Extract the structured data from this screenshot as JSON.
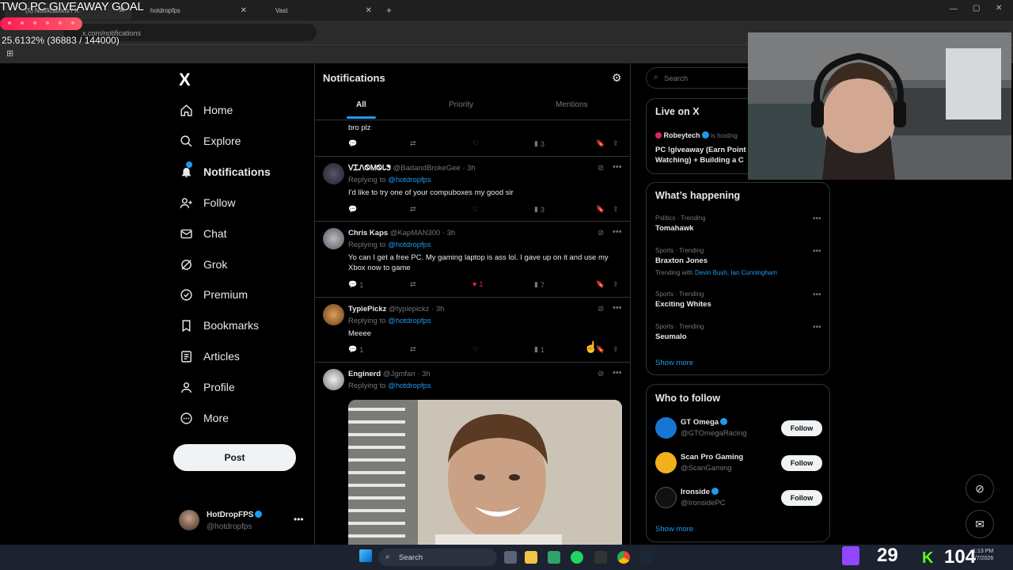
{
  "overlay": {
    "goal_title": "TWO PC GIVEAWAY GOAL",
    "goal_progress": "25.6132% (36883 / 144000)",
    "goal_fraction": 0.256
  },
  "browser": {
    "tabs": [
      {
        "label": "(5) Notifications / X"
      },
      {
        "label": "hotdropfps"
      },
      {
        "label": "Vast"
      }
    ],
    "new_tab": "+",
    "url": "x.com/notifications"
  },
  "sidebar": {
    "logo": "X",
    "items": [
      {
        "label": "Home",
        "icon": "home-icon"
      },
      {
        "label": "Explore",
        "icon": "search-icon"
      },
      {
        "label": "Notifications",
        "icon": "bell-icon",
        "active": true
      },
      {
        "label": "Follow",
        "icon": "person-add-icon"
      },
      {
        "label": "Chat",
        "icon": "mail-icon"
      },
      {
        "label": "Grok",
        "icon": "grok-icon"
      },
      {
        "label": "Premium",
        "icon": "premium-icon"
      },
      {
        "label": "Bookmarks",
        "icon": "bookmark-icon"
      },
      {
        "label": "Articles",
        "icon": "articles-icon"
      },
      {
        "label": "Profile",
        "icon": "profile-icon"
      },
      {
        "label": "More",
        "icon": "more-circle-icon"
      }
    ],
    "post_label": "Post",
    "account": {
      "name": "HotDropFPS",
      "handle": "@hotdropfps"
    }
  },
  "notifications": {
    "title": "Notifications",
    "tabs": [
      "All",
      "Priority",
      "Mentions"
    ],
    "posts": [
      {
        "name": "",
        "handle": "",
        "time": "",
        "reply_to": "",
        "text": "bro plz",
        "replies": "",
        "likes": "",
        "views": "3"
      },
      {
        "name": "ᐯᏆᏁᏫᎷᏫᏓᏕ",
        "handle": "@BadandBrokeGee · 3h",
        "reply_label": "Replying to ",
        "reply_to": "@hotdropfps",
        "text": "I'd like to try one of your compuboxes my good sir",
        "replies": "",
        "likes": "",
        "views": "3"
      },
      {
        "name": "Chris Kaps",
        "handle": "@KapMAN300 · 3h",
        "reply_label": "Replying to ",
        "reply_to": "@hotdropfps",
        "text": "Yo can I get a free PC. My gaming laptop is ass lol. I gave up on it and use my Xbox now to game",
        "replies": "1",
        "likes": "1",
        "views": "7"
      },
      {
        "name": "TypiePickz",
        "handle": "@typiepickz · 3h",
        "reply_label": "Replying to ",
        "reply_to": "@hotdropfps",
        "text": "Meeee",
        "replies": "1",
        "likes": "",
        "views": "1"
      },
      {
        "name": "Enginerd",
        "handle": "@Jgmfan · 3h",
        "reply_label": "Replying to ",
        "reply_to": "@hotdropfps",
        "text": ""
      }
    ]
  },
  "right": {
    "search_placeholder": "Search",
    "live": {
      "title": "Live on X",
      "host": "Robeytech",
      "host_suffix": "is hosting",
      "stream_title": "PC !giveaway (Earn Point Watching) + Building a C"
    },
    "happening": {
      "title": "What’s happening",
      "trends": [
        {
          "meta": "Politics · Trending",
          "name": "Tomahawk",
          "extra": ""
        },
        {
          "meta": "Sports · Trending",
          "name": "Braxton Jones",
          "extra_label": "Trending with ",
          "extra": "Devin Bush, Ian Cunningham"
        },
        {
          "meta": "Sports · Trending",
          "name": "Exciting Whites",
          "extra": ""
        },
        {
          "meta": "Sports · Trending",
          "name": "Seumalo",
          "extra": ""
        }
      ],
      "show_more": "Show more"
    },
    "who_to_follow": {
      "title": "Who to follow",
      "accounts": [
        {
          "name": "GT Omega",
          "handle": "@GTOmegaRacing",
          "button": "Follow"
        },
        {
          "name": "Scan Pro Gaming",
          "handle": "@ScanGaming",
          "button": "Follow"
        },
        {
          "name": "Ironside",
          "handle": "@IronsidePC",
          "button": "Follow"
        }
      ],
      "show_more": "Show more"
    }
  },
  "taskbar": {
    "search": "Search",
    "counter_a": "29",
    "counter_b": "104",
    "time": "1:13 PM",
    "date": "5/7/2026"
  },
  "colors": {
    "accent": "#1d9bf0",
    "like": "#f91880",
    "bg": "#000000",
    "border": "#2f3336"
  }
}
